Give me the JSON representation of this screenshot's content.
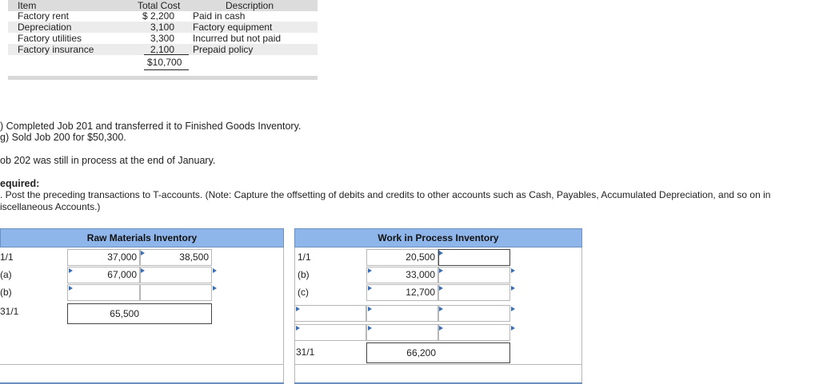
{
  "cost_table": {
    "headers": {
      "item": "Item",
      "total_cost": "Total Cost",
      "description": "Description"
    },
    "rows": [
      {
        "item": "Factory rent",
        "cost": "$ 2,200",
        "description": "Paid in cash"
      },
      {
        "item": "Depreciation",
        "cost": "3,100",
        "description": "Factory equipment"
      },
      {
        "item": "Factory utilities",
        "cost": "3,300",
        "description": "Incurred but not paid"
      },
      {
        "item": "Factory insurance",
        "cost": "2,100",
        "description": "Prepaid policy"
      }
    ],
    "total": "$10,700"
  },
  "transactions": {
    "line_f": ") Completed Job 201 and transferred it to Finished Goods Inventory.",
    "line_g": "g) Sold Job 200 for $50,300.",
    "job_note": "ob 202 was still in process at the end of January."
  },
  "required": {
    "heading": "equired:",
    "line1": ". Post the preceding transactions to T-accounts. (Note: Capture the offsetting of debits and credits to other accounts such as Cash, Payables, Accumulated Depreciation, and so on in",
    "line2": "iscellaneous Accounts.)"
  },
  "raw_materials": {
    "title": "Raw Materials Inventory",
    "rows": [
      {
        "label": "1/1",
        "debit": "37,000",
        "credit": "38,500"
      },
      {
        "label": "(a)",
        "debit": "67,000",
        "credit": ""
      },
      {
        "label": "(b)",
        "debit": "",
        "credit": ""
      },
      {
        "label": "31/1",
        "debit": "65,500",
        "credit": ""
      }
    ]
  },
  "wip": {
    "title": "Work in Process Inventory",
    "rows": [
      {
        "label": "1/1",
        "debit": "20,500",
        "credit": ""
      },
      {
        "label": "(b)",
        "debit": "33,000",
        "credit": ""
      },
      {
        "label": "(c)",
        "debit": "12,700",
        "credit": ""
      },
      {
        "label": "",
        "debit": "",
        "credit": ""
      },
      {
        "label": "",
        "debit": "",
        "credit": ""
      },
      {
        "label": "31/1",
        "debit": "66,200",
        "credit": ""
      }
    ]
  }
}
